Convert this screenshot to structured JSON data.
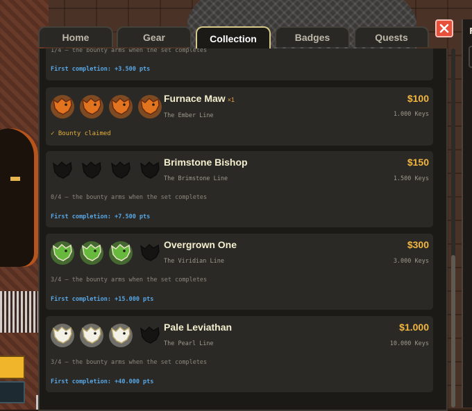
{
  "tabs": [
    {
      "label": "Home",
      "active": false
    },
    {
      "label": "Gear",
      "active": false
    },
    {
      "label": "Collection",
      "active": true
    },
    {
      "label": "Badges",
      "active": false
    },
    {
      "label": "Quests",
      "active": false
    }
  ],
  "close_icon": "close-icon",
  "partial_card": {
    "bounty_text": "1/4 — the bounty arms when the set completes",
    "first_completion": "First completion: +3.500 pts"
  },
  "cards": [
    {
      "title": "Furnace Maw",
      "multiplier": "×1",
      "line": "The Ember Line",
      "price": "$100",
      "keys": "1.000 Keys",
      "status": "✓ Bounty claimed",
      "icon": "ember-fish-icon",
      "owned": 4,
      "total": 4
    },
    {
      "title": "Brimstone Bishop",
      "line": "The Brimstone Line",
      "price": "$150",
      "keys": "1.500 Keys",
      "bounty_text": "0/4 — the bounty arms when the set completes",
      "first_completion": "First completion: +7.500 pts",
      "icon": "brimstone-fish-icon",
      "owned": 0,
      "total": 4
    },
    {
      "title": "Overgrown One",
      "line": "The Viridian Line",
      "price": "$300",
      "keys": "3.000 Keys",
      "bounty_text": "3/4 — the bounty arms when the set completes",
      "first_completion": "First completion: +15.000 pts",
      "icon": "viridian-fish-icon",
      "owned": 3,
      "total": 4
    },
    {
      "title": "Pale Leviathan",
      "line": "The Pearl Line",
      "price": "$1.000",
      "keys": "10.000 Keys",
      "bounty_text": "3/4 — the bounty arms when the set completes",
      "first_completion": "First completion: +40.000 pts",
      "icon": "pearl-fish-icon",
      "owned": 3,
      "total": 4
    }
  ],
  "colors": {
    "accent": "#f2b63f",
    "points": "#58a7e6",
    "close": "#e9503b",
    "ember": "#e2741f",
    "viridian": "#67b93e",
    "pearl": "#f3f0e6"
  }
}
